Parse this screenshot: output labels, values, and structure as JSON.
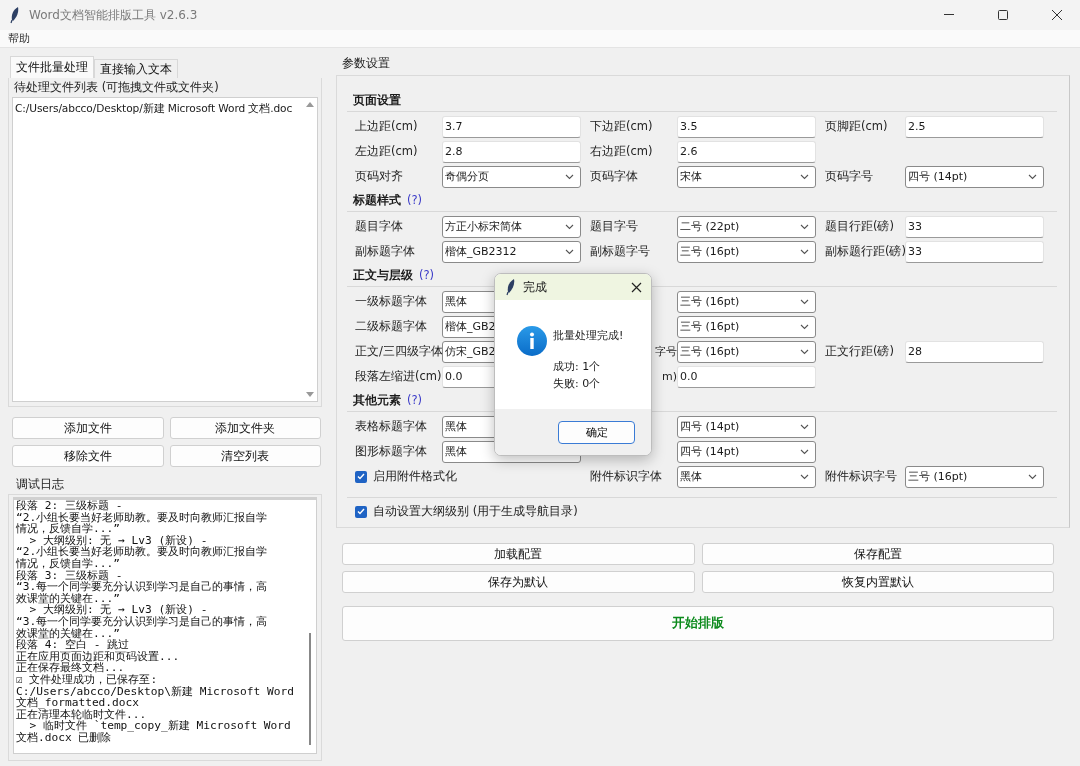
{
  "window": {
    "title": "Word文档智能排版工具 v2.6.3"
  },
  "menu": [
    "帮助"
  ],
  "tabs": [
    {
      "label": "文件批量处理",
      "selected": true
    },
    {
      "label": "直接输入文本",
      "selected": false
    }
  ],
  "file_list": {
    "title": "待处理文件列表 (可拖拽文件或文件夹)",
    "items": [
      "C:/Users/abcco/Desktop/新建 Microsoft Word 文档.doc"
    ]
  },
  "file_buttons": [
    "添加文件",
    "添加文件夹",
    "移除文件",
    "清空列表"
  ],
  "log": {
    "title": "调试日志",
    "lines": [
      "段落 2: 三级标题 -",
      "“2.小组长要当好老师助教。要及时向教师汇报自学",
      "情况，反馈自学...”",
      "  > 大纲级别: 无 → Lv3 (新设) -",
      "“2.小组长要当好老师助教。要及时向教师汇报自学",
      "情况，反馈自学...”",
      "段落 3: 三级标题 -",
      "“3.每一个同学要充分认识到学习是自己的事情，高",
      "效课堂的关键在...”",
      "  > 大纲级别: 无 → Lv3 (新设) -",
      "“3.每一个同学要充分认识到学习是自己的事情，高",
      "效课堂的关键在...”",
      "段落 4: 空白 - 跳过",
      "正在应用页面边距和页码设置...",
      "正在保存最终文档...",
      "☑ 文件处理成功，已保存至:",
      "C:/Users/abcco/Desktop\\新建 Microsoft Word",
      "文档_formatted.docx",
      "正在清理本轮临时文件...",
      "  > 临时文件 `temp_copy_新建 Microsoft Word",
      "文档.docx 已删除"
    ]
  },
  "params": {
    "title": "参数设置",
    "sections": [
      {
        "title": "页面设置",
        "rows": [
          [
            {
              "kind": "entry",
              "label": "上边距(cm)",
              "value": "3.7"
            },
            {
              "kind": "entry",
              "label": "下边距(cm)",
              "value": "3.5"
            },
            {
              "kind": "entry",
              "label": "页脚距(cm)",
              "value": "2.5"
            }
          ],
          [
            {
              "kind": "entry",
              "label": "左边距(cm)",
              "value": "2.8"
            },
            {
              "kind": "entry",
              "label": "右边距(cm)",
              "value": "2.6"
            }
          ],
          [
            {
              "kind": "combo",
              "label": "页码对齐",
              "value": "奇偶分页"
            },
            {
              "kind": "combo",
              "label": "页码字体",
              "value": "宋体"
            },
            {
              "kind": "combo",
              "label": "页码字号",
              "value": "四号 (14pt)"
            }
          ]
        ]
      },
      {
        "title": "标题样式",
        "help": "(?)",
        "rows": [
          [
            {
              "kind": "combo",
              "label": "题目字体",
              "value": "方正小标宋简体"
            },
            {
              "kind": "combo",
              "label": "题目字号",
              "value": "二号 (22pt)"
            },
            {
              "kind": "entry",
              "label": "题目行距(磅)",
              "value": "33"
            }
          ],
          [
            {
              "kind": "combo",
              "label": "副标题字体",
              "value": "楷体_GB2312"
            },
            {
              "kind": "combo",
              "label": "副标题字号",
              "value": "三号 (16pt)"
            },
            {
              "kind": "entry",
              "label": "副标题行距(磅)",
              "value": "33"
            }
          ]
        ]
      },
      {
        "title": "正文与层级",
        "help": "(?)",
        "rows": [
          [
            {
              "kind": "combo",
              "label": "一级标题字体",
              "value": "黑体",
              "arrow_covered": true
            },
            {
              "kind": "combo",
              "value": "三号 (16pt)"
            }
          ],
          [
            {
              "kind": "combo",
              "label": "二级标题字体",
              "value": "楷体_GB2",
              "arrow_covered": true
            },
            {
              "kind": "combo",
              "value": "三号 (16pt)"
            }
          ],
          [
            {
              "kind": "combo",
              "label": "正文/三四级字体",
              "value": "仿宋_GB2",
              "arrow_covered": true
            },
            {
              "kind": "combo",
              "label": "字号",
              "covered": true,
              "value": "三号 (16pt)"
            },
            {
              "kind": "entry",
              "label": "正文行距(磅)",
              "value": "28"
            }
          ],
          [
            {
              "kind": "entry",
              "label": "段落左缩进(cm)",
              "value": "0.0"
            },
            {
              "kind": "entry",
              "label": "m)",
              "covered": true,
              "value": "0.0"
            }
          ]
        ]
      },
      {
        "title": "其他元素",
        "help": "(?)",
        "rows": [
          [
            {
              "kind": "combo",
              "label": "表格标题字体",
              "value": "黑体",
              "arrow_covered": true
            },
            {
              "kind": "combo",
              "value": "四号 (14pt)"
            }
          ],
          [
            {
              "kind": "combo",
              "label": "图形标题字体",
              "value": "黑体",
              "arrow_covered": true
            },
            {
              "kind": "combo",
              "value": "四号 (14pt)"
            }
          ],
          [
            {
              "kind": "check",
              "label": "启用附件格式化",
              "checked": true
            },
            {
              "kind": "combo",
              "label": "附件标识字体",
              "value": "黑体"
            },
            {
              "kind": "combo",
              "label": "附件标识字号",
              "value": "三号 (16pt)"
            }
          ]
        ]
      }
    ],
    "outline_option": {
      "label": "自动设置大纲级别 (用于生成导航目录)",
      "checked": true
    }
  },
  "config_buttons": [
    "加载配置",
    "保存配置",
    "保存为默认",
    "恢复内置默认"
  ],
  "start_button": "开始排版",
  "dialog": {
    "title": "完成",
    "message": "批量处理完成!",
    "details": [
      "成功: 1个",
      "失败: 0个"
    ],
    "button": "确定"
  }
}
